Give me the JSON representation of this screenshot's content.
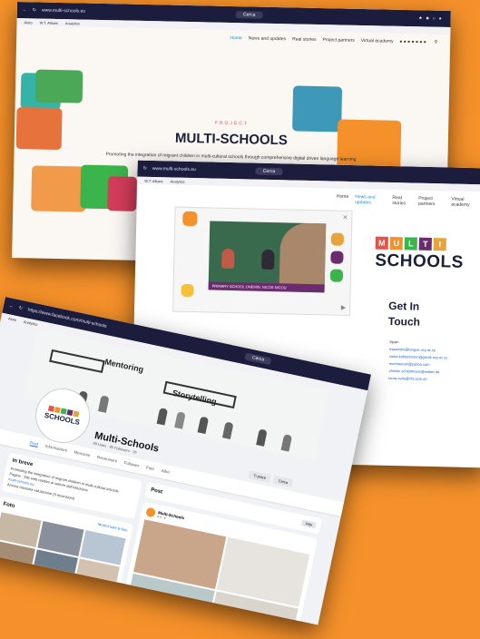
{
  "brand": {
    "orange": "#f5912a",
    "navy": "#1a1f3a",
    "purple": "#6b2c6f"
  },
  "site": {
    "url": "www.multi-schools.eu",
    "search": "Cerca",
    "bookmarks": [
      "Aiuto",
      "W.T. Allows",
      "Analytics"
    ],
    "nav": [
      "Home",
      "News and updates",
      "Real stories",
      "Project partners",
      "Virtual academy"
    ],
    "kicker": "PROJECT",
    "title": "MULTI-SCHOOLS",
    "description": "Promoting the integration of migrant children in multi-cultural schools through comprehensive digital driven language learning and family civic engagement"
  },
  "partners_page": {
    "url": "www.multi-schools.eu",
    "video_caption": "PRIMARY SCHOOL ONEMIN, NICOS NICOU",
    "logo_letters": [
      "M",
      "U",
      "L",
      "T",
      "I"
    ],
    "logo_word": "SCHOOLS",
    "get_in_touch": [
      "Get In",
      "Touch"
    ],
    "spain_label": "Spain",
    "contacts": [
      "mpassoni@tongue.ucy.ac.cy",
      "costa.kohlenbrunn@greek.ucy.ac.cy",
      "murstaurani@yahoo.com",
      "christin.schlottmann@weber.de",
      "laura.xarlo@rits.acm.ch"
    ]
  },
  "facebook": {
    "url": "https://www.facebook.com/multi-schools",
    "search": "Cerca",
    "cover_labels": [
      "Mentoring",
      "Storytelling"
    ],
    "avatar_letters": [
      "M",
      "U",
      "L",
      "T",
      "I"
    ],
    "avatar_word": "SCHOOLS",
    "page_name": "Multi-Schools",
    "page_meta": "99 Likes · 95 Followers · 26",
    "follow_button": "Ti piace",
    "search_button": "Cerca",
    "tabs": [
      "Post",
      "Informazioni",
      "Menzioni",
      "Recensioni",
      "Follower",
      "Foto",
      "Altro"
    ],
    "intro_title": "In breve",
    "intro_text": "Promoting the integration of migrant children in multi-cultural schools",
    "intro_category": "Pagina · Sito web relativo al settore dell'istruzione",
    "intro_link": "multi-schools.eu",
    "intro_reviews": "Ancora nessuna valutazione (0 recensioni)",
    "photos_title": "Foto",
    "photos_all": "Mostra tutte le foto",
    "posts_title": "Post",
    "posts_filter": "Filtri",
    "post_author": "Multi-Schools",
    "post_time": "8 h · é"
  }
}
